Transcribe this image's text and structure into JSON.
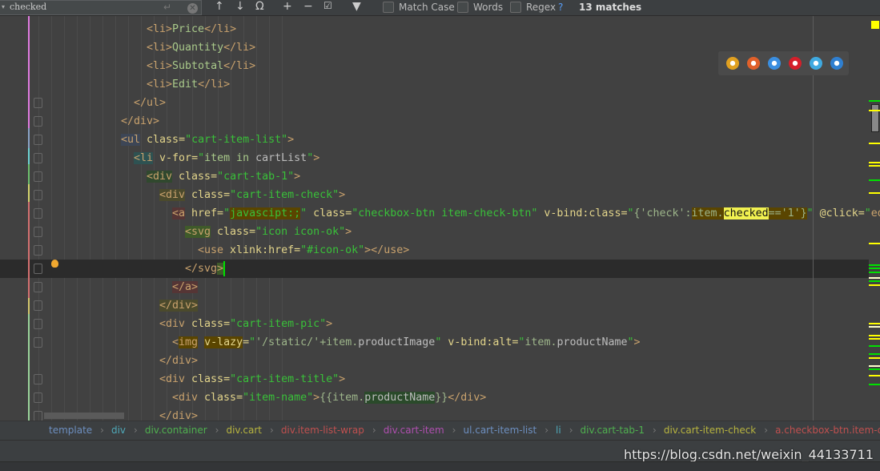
{
  "find_bar": {
    "query": "checked",
    "match_case_label": "Match Case",
    "words_label": "Words",
    "regex_label": "Regex",
    "regex_help": "?",
    "match_count": "13 matches",
    "icons": [
      "search-history-icon",
      "enter-icon",
      "clear-icon",
      "prev-occurrence-icon",
      "next-occurrence-icon",
      "find-all-icon",
      "add-occurrence-icon",
      "remove-occurrence-icon",
      "select-all-occurrences-icon",
      "filter-icon"
    ]
  },
  "editor": {
    "current_line": 14,
    "lines": [
      {
        "indent": 23,
        "tokens": [
          [
            "b",
            "<li>"
          ],
          [
            "t",
            "Price"
          ],
          [
            "b",
            "</li>"
          ]
        ]
      },
      {
        "indent": 23,
        "tokens": [
          [
            "b",
            "<li>"
          ],
          [
            "t",
            "Quantity"
          ],
          [
            "b",
            "</li>"
          ]
        ]
      },
      {
        "indent": 23,
        "tokens": [
          [
            "b",
            "<li>"
          ],
          [
            "t",
            "Subtotal"
          ],
          [
            "b",
            "</li>"
          ]
        ]
      },
      {
        "indent": 23,
        "tokens": [
          [
            "b",
            "<li>"
          ],
          [
            "t",
            "Edit"
          ],
          [
            "b",
            "</li>"
          ]
        ]
      },
      {
        "indent": 21,
        "tokens": [
          [
            "b",
            "</ul>"
          ]
        ]
      },
      {
        "indent": 19,
        "tokens": [
          [
            "b",
            "</div>"
          ]
        ]
      },
      {
        "indent": 19,
        "tokens": [
          [
            "b",
            "<ul",
            "#3d4656"
          ],
          [
            "a",
            " class="
          ],
          [
            "s",
            "\"cart-item-list\""
          ],
          [
            "b",
            ">"
          ]
        ]
      },
      {
        "indent": 21,
        "tokens": [
          [
            "b",
            "<li",
            "#2e5252"
          ],
          [
            "a",
            " v-for="
          ],
          [
            "s",
            "\""
          ],
          [
            "t",
            "item in "
          ],
          [
            "e",
            "cartList"
          ],
          [
            "s",
            "\""
          ],
          [
            "b",
            ">"
          ]
        ]
      },
      {
        "indent": 23,
        "tokens": [
          [
            "b",
            "<div",
            "#30482e"
          ],
          [
            "a",
            " class="
          ],
          [
            "s",
            "\"cart-tab-1\""
          ],
          [
            "b",
            ">"
          ]
        ]
      },
      {
        "indent": 25,
        "tokens": [
          [
            "b",
            "<div",
            "#4b4a2c"
          ],
          [
            "a",
            " class="
          ],
          [
            "s",
            "\"cart-item-check\""
          ],
          [
            "b",
            ">"
          ]
        ]
      },
      {
        "indent": 27,
        "tokens": [
          [
            "b",
            "<a",
            "#553535"
          ],
          [
            "a",
            " href="
          ],
          [
            "s",
            "\""
          ],
          [
            "s",
            "javascipt:;",
            "#5a4500"
          ],
          [
            "s",
            "\""
          ],
          [
            "a",
            " class="
          ],
          [
            "s",
            "\"checkbox-btn item-check-btn\""
          ],
          [
            "a",
            " v-bind:class="
          ],
          [
            "s",
            "\""
          ],
          [
            "p",
            "{'check':"
          ],
          [
            "p",
            "item.",
            "#5a4500"
          ],
          [
            "hy",
            "checked"
          ],
          [
            "p",
            "=='1'}",
            "#5a4500"
          ],
          [
            "s",
            "\""
          ],
          [
            "a",
            " @click="
          ],
          [
            "s",
            "\""
          ],
          [
            "b",
            "ed"
          ]
        ]
      },
      {
        "indent": 29,
        "tokens": [
          [
            "b",
            "<svg",
            "#3f5a2a"
          ],
          [
            "a",
            " class="
          ],
          [
            "s",
            "\"icon icon-ok\""
          ],
          [
            "b",
            ">"
          ]
        ]
      },
      {
        "indent": 31,
        "tokens": [
          [
            "b",
            "<use"
          ],
          [
            "a",
            " xlink:href="
          ],
          [
            "s",
            "\"#icon-ok\""
          ],
          [
            "b",
            "></use>"
          ]
        ]
      },
      {
        "indent": 29,
        "tokens": [
          [
            "b",
            "</svg"
          ],
          [
            "b",
            ">",
            "#3f5a2a"
          ]
        ]
      },
      {
        "indent": 27,
        "tokens": [
          [
            "b",
            "</a>",
            "#553535"
          ]
        ]
      },
      {
        "indent": 25,
        "tokens": [
          [
            "b",
            "</div>",
            "#4b4a2c"
          ]
        ]
      },
      {
        "indent": 25,
        "tokens": [
          [
            "b",
            "<div"
          ],
          [
            "a",
            " class="
          ],
          [
            "s",
            "\"cart-item-pic\""
          ],
          [
            "b",
            ">"
          ]
        ]
      },
      {
        "indent": 27,
        "tokens": [
          [
            "b",
            "<"
          ],
          [
            "b",
            "img",
            "#5a4500"
          ],
          [
            "a",
            " "
          ],
          [
            "a",
            "v-lazy",
            "#5a4500"
          ],
          [
            "a",
            "="
          ],
          [
            "s",
            "\""
          ],
          [
            "p",
            "'/static/'+item."
          ],
          [
            "e",
            "productImage"
          ],
          [
            "s",
            "\""
          ],
          [
            "a",
            " v-bind:alt="
          ],
          [
            "s",
            "\""
          ],
          [
            "p",
            "item."
          ],
          [
            "e",
            "productName"
          ],
          [
            "s",
            "\""
          ],
          [
            "b",
            ">"
          ]
        ]
      },
      {
        "indent": 25,
        "tokens": [
          [
            "b",
            "</div>"
          ]
        ]
      },
      {
        "indent": 25,
        "tokens": [
          [
            "b",
            "<div"
          ],
          [
            "a",
            " class="
          ],
          [
            "s",
            "\"cart-item-title\""
          ],
          [
            "b",
            ">"
          ]
        ]
      },
      {
        "indent": 27,
        "tokens": [
          [
            "b",
            "<div"
          ],
          [
            "a",
            " class="
          ],
          [
            "s",
            "\"item-name\""
          ],
          [
            "b",
            ">"
          ],
          [
            "p",
            "{{item."
          ],
          [
            "e",
            "productName",
            "#2a4a2a"
          ],
          [
            "p",
            "}}"
          ],
          [
            "b",
            "</div>"
          ]
        ]
      },
      {
        "indent": 25,
        "tokens": [
          [
            "b",
            "</div>"
          ]
        ]
      }
    ]
  },
  "browser_icons": [
    {
      "name": "chrome",
      "color": "#e0a020"
    },
    {
      "name": "firefox",
      "color": "#e0602a"
    },
    {
      "name": "safari",
      "color": "#3a8ee0"
    },
    {
      "name": "opera",
      "color": "#d41f2a"
    },
    {
      "name": "internet-explorer",
      "color": "#3fa9e0"
    },
    {
      "name": "edge",
      "color": "#2f7fd0"
    }
  ],
  "breadcrumbs": [
    {
      "label": "template",
      "color": "#6d8fc0"
    },
    {
      "label": "div",
      "color": "#4fa8b8"
    },
    {
      "label": "div.container",
      "color": "#4fb04f"
    },
    {
      "label": "div.cart",
      "color": "#b7b43f"
    },
    {
      "label": "div.item-list-wrap",
      "color": "#c0504f"
    },
    {
      "label": "div.cart-item",
      "color": "#b04fb0"
    },
    {
      "label": "ul.cart-item-list",
      "color": "#6d8fc0"
    },
    {
      "label": "li",
      "color": "#4fa8b8"
    },
    {
      "label": "div.cart-tab-1",
      "color": "#4fb04f"
    },
    {
      "label": "div.cart-item-check",
      "color": "#b7b43f"
    },
    {
      "label": "a.checkbox-btn.item-check-b",
      "color": "#c0504f"
    }
  ],
  "watermark": "https://blog.csdn.net/weixin_44133711"
}
